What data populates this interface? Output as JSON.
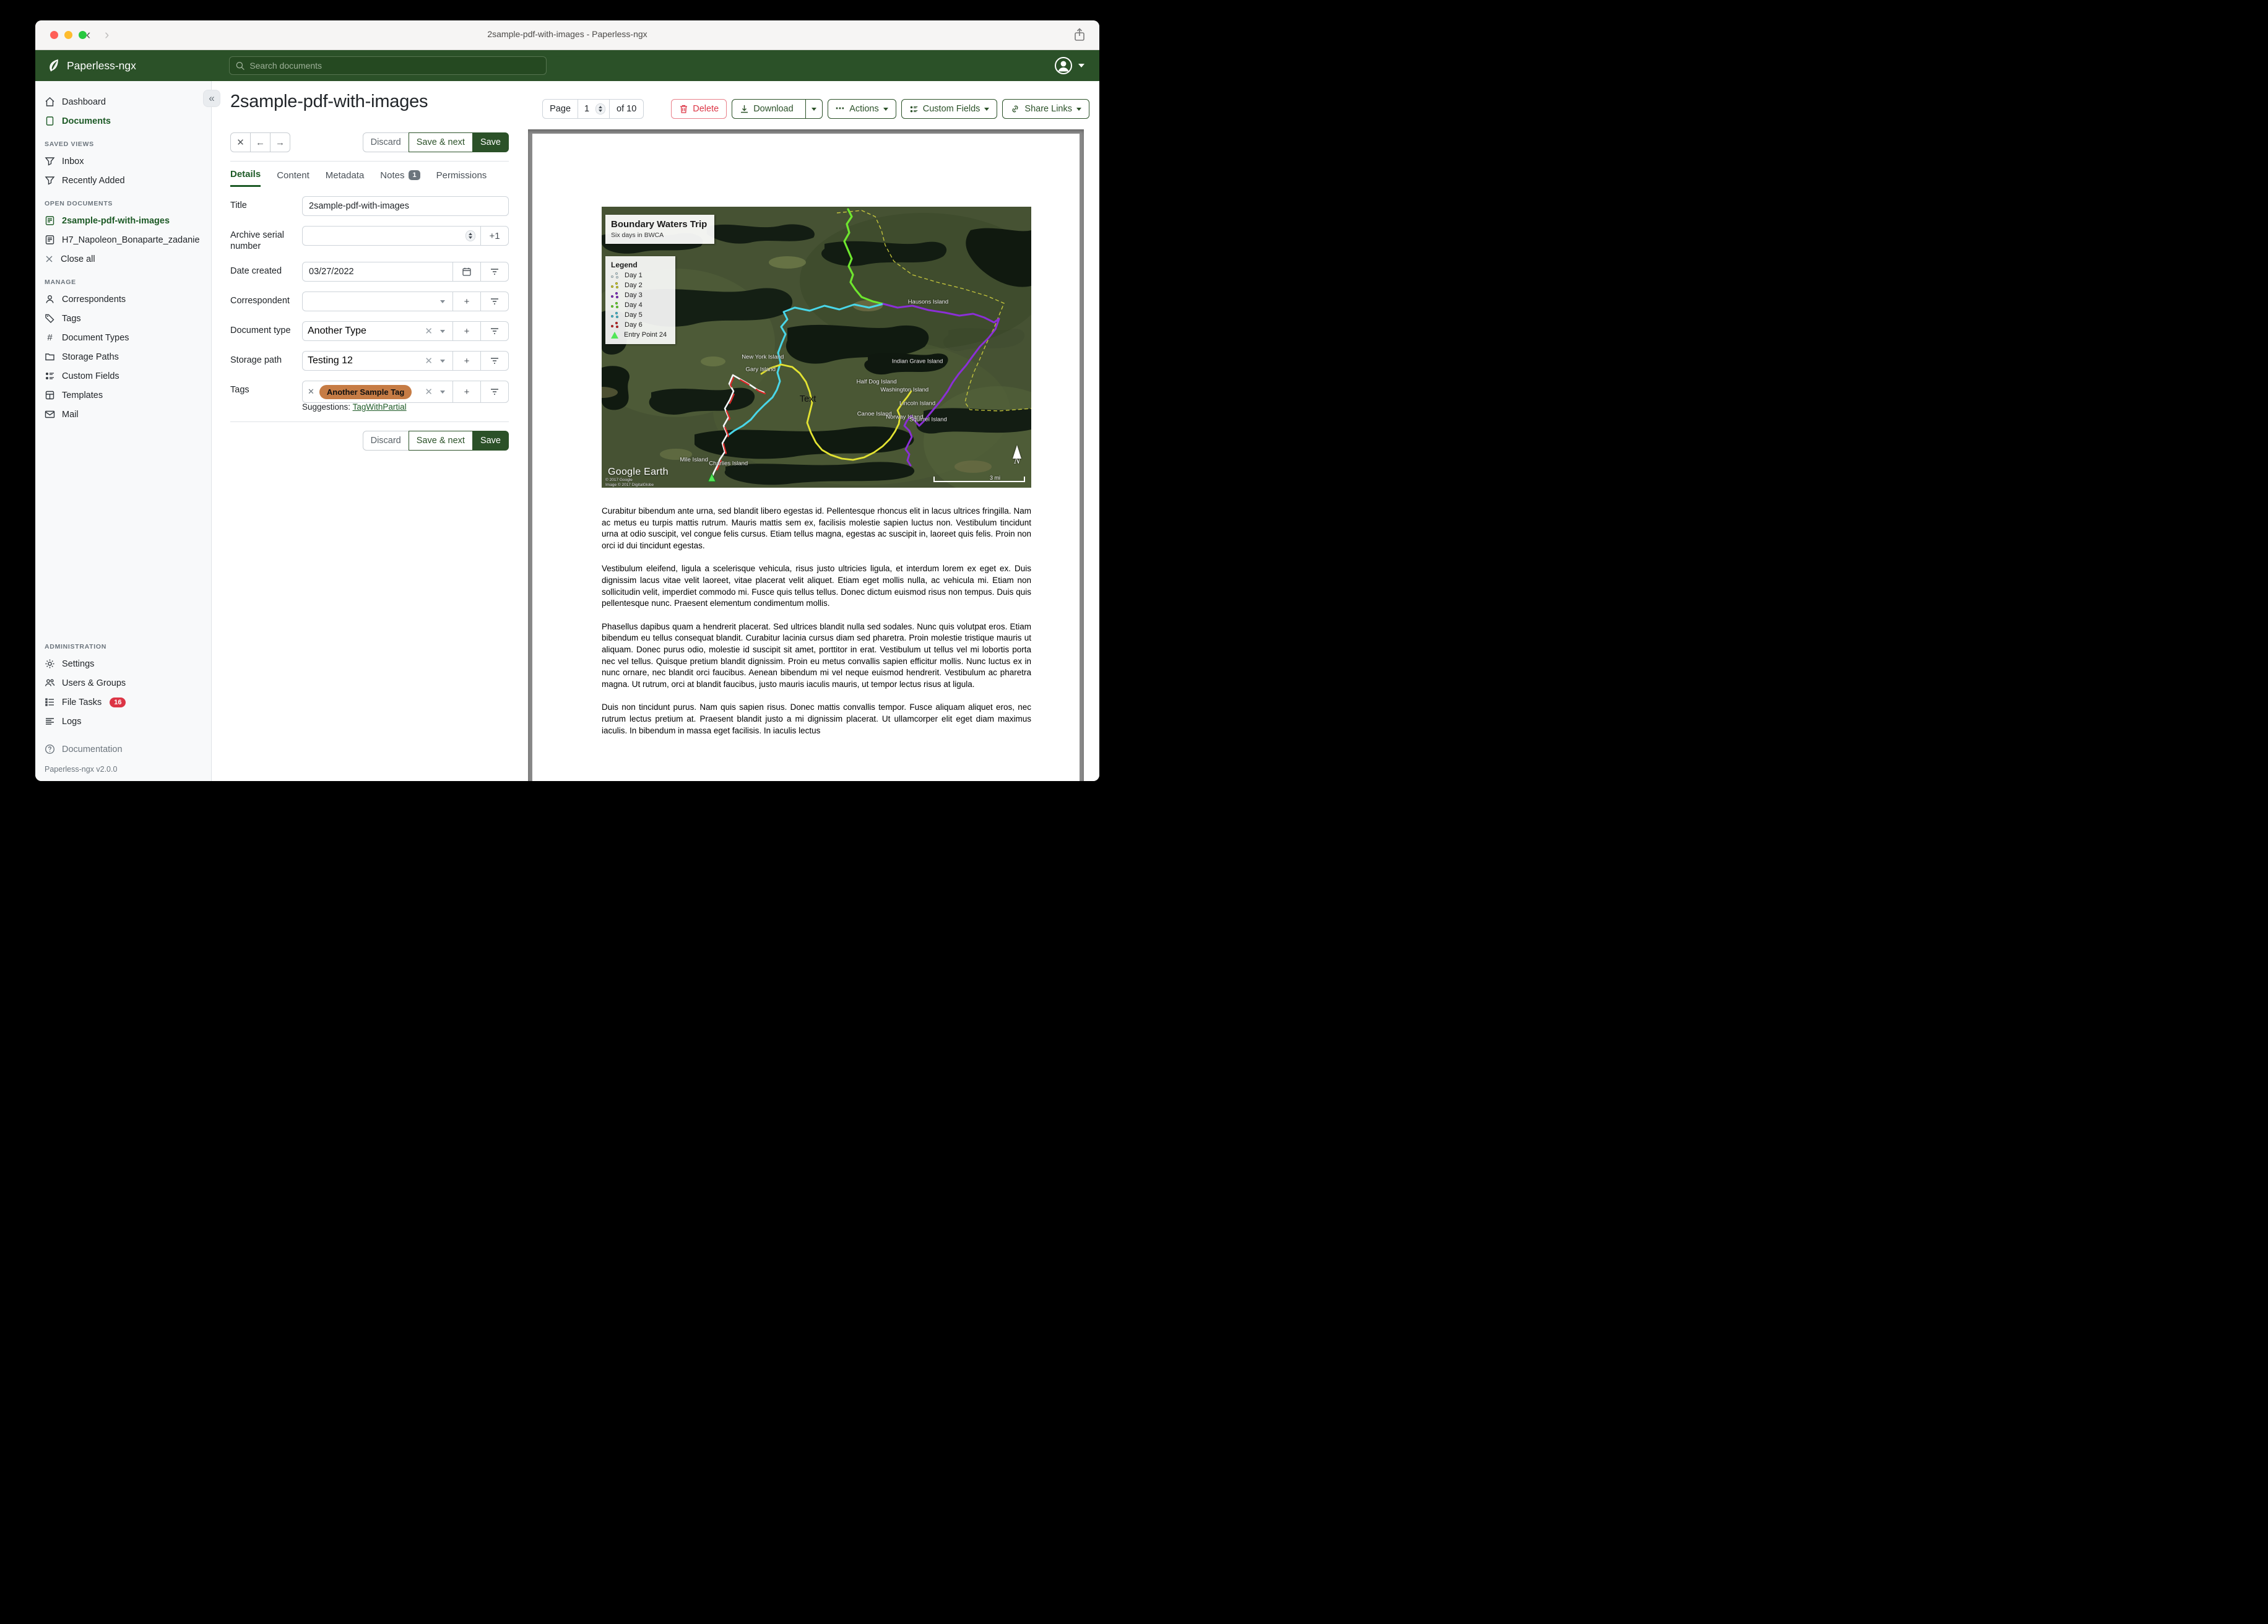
{
  "window": {
    "title": "2sample-pdf-with-images - Paperless-ngx"
  },
  "navbar": {
    "brand": "Paperless-ngx",
    "search_placeholder": "Search documents"
  },
  "sidebar": {
    "dashboard": "Dashboard",
    "documents": "Documents",
    "saved_views_header": "SAVED VIEWS",
    "inbox": "Inbox",
    "recently_added": "Recently Added",
    "open_documents_header": "OPEN DOCUMENTS",
    "open_doc_1": "2sample-pdf-with-images",
    "open_doc_2": "H7_Napoleon_Bonaparte_zadanie",
    "close_all": "Close all",
    "manage_header": "MANAGE",
    "correspondents": "Correspondents",
    "tags": "Tags",
    "document_types": "Document Types",
    "storage_paths": "Storage Paths",
    "custom_fields": "Custom Fields",
    "templates": "Templates",
    "mail": "Mail",
    "administration_header": "ADMINISTRATION",
    "settings": "Settings",
    "users_groups": "Users & Groups",
    "file_tasks": "File Tasks",
    "file_tasks_badge": "16",
    "logs": "Logs",
    "documentation": "Documentation",
    "version": "Paperless-ngx v2.0.0"
  },
  "toolbar": {
    "page_label": "Page",
    "page_value": "1",
    "page_of": "of 10",
    "delete": "Delete",
    "download": "Download",
    "actions": "Actions",
    "custom_fields": "Custom Fields",
    "share_links": "Share Links"
  },
  "document": {
    "heading": "2sample-pdf-with-images",
    "tabs": {
      "details": "Details",
      "content": "Content",
      "metadata": "Metadata",
      "notes": "Notes",
      "notes_badge": "1",
      "permissions": "Permissions"
    },
    "buttons": {
      "discard": "Discard",
      "save_next": "Save & next",
      "save": "Save",
      "close": "✕",
      "prev": "←",
      "next": "→"
    },
    "fields": {
      "title_label": "Title",
      "title_value": "2sample-pdf-with-images",
      "asn_label": "Archive serial number",
      "asn_value": "",
      "asn_plus": "+1",
      "date_label": "Date created",
      "date_value": "03/27/2022",
      "correspondent_label": "Correspondent",
      "correspondent_value": "",
      "doctype_label": "Document type",
      "doctype_value": "Another Type",
      "storage_label": "Storage path",
      "storage_value": "Testing 12",
      "tags_label": "Tags",
      "tag_chip": "Another Sample Tag",
      "suggestions_label": "Suggestions:",
      "suggestion_link": "TagWithPartial"
    },
    "paragraphs": [
      "Curabitur bibendum ante urna, sed blandit libero egestas id. Pellentesque rhoncus elit in lacus ultrices fringilla. Nam ac metus eu turpis mattis rutrum. Mauris mattis sem ex, facilisis molestie sapien luctus non. Vestibulum tincidunt urna at odio suscipit, vel congue felis cursus. Etiam tellus magna, egestas ac suscipit in, laoreet quis felis. Proin non orci id dui tincidunt egestas.",
      "Vestibulum eleifend, ligula a scelerisque vehicula, risus justo ultricies ligula, et interdum lorem ex eget ex. Duis dignissim lacus vitae velit laoreet, vitae placerat velit aliquet. Etiam eget mollis nulla, ac vehicula mi. Etiam non sollicitudin velit, imperdiet commodo mi. Fusce quis tellus tellus. Donec dictum euismod risus non tempus. Duis quis pellentesque nunc. Praesent elementum condimentum mollis.",
      "Phasellus dapibus quam a hendrerit placerat. Sed ultrices blandit nulla sed sodales. Nunc quis volutpat eros. Etiam bibendum eu tellus consequat blandit. Curabitur lacinia cursus diam sed pharetra. Proin molestie tristique mauris ut aliquam. Donec purus odio, molestie id suscipit sit amet, porttitor in erat. Vestibulum ut tellus vel mi lobortis porta nec vel tellus. Quisque pretium blandit dignissim. Proin eu metus convallis sapien efficitur mollis. Nunc luctus ex in nunc ornare, nec blandit orci faucibus. Aenean bibendum mi vel neque euismod hendrerit. Vestibulum ac pharetra magna. Ut rutrum, orci at blandit faucibus, justo mauris iaculis mauris, ut tempor lectus risus at ligula.",
      "Duis non tincidunt purus. Nam quis sapien risus. Donec mattis convallis tempor. Fusce aliquam aliquet eros, nec rutrum lectus pretium at. Praesent blandit justo a mi dignissim placerat. Ut ullamcorper elit eget diam maximus iaculis. In bibendum in massa eget facilisis. In iaculis lectus"
    ]
  },
  "map": {
    "title": "Boundary Waters Trip",
    "subtitle": "Six days in BWCA",
    "legend_title": "Legend",
    "legend": [
      {
        "label": "Day 1",
        "color": "#dcedf2"
      },
      {
        "label": "Day 2",
        "color": "#d8d832"
      },
      {
        "label": "Day 3",
        "color": "#8b2fd6"
      },
      {
        "label": "Day 4",
        "color": "#6ee62e"
      },
      {
        "label": "Day 5",
        "color": "#49c8e0"
      },
      {
        "label": "Day 6",
        "color": "#d62828"
      },
      {
        "label": "Entry Point 24",
        "color": "#52e658"
      }
    ],
    "labels": [
      "Hausons Island",
      "New York Island",
      "Gary Island",
      "Indian Grave Island",
      "Half Dog Island",
      "Washington Island",
      "Lincoln Island",
      "Canoe Island",
      "Norway Island",
      "Squirrel Island",
      "Mile Island",
      "Charlies Island"
    ],
    "text_annotation": "Text",
    "google_earth": "Google Earth",
    "copyright1": "© 2017 Google",
    "copyright2": "Image © 2017 DigitalGlobe",
    "scale_label": "3 mi",
    "north_label": "N"
  },
  "colors": {
    "navbar_green": "#2b5128",
    "accent_green": "#1d5a26",
    "danger_red": "#dc3545",
    "tag_orange": "#c67c45",
    "pdf_frame_gray": "#8a8a8a"
  }
}
